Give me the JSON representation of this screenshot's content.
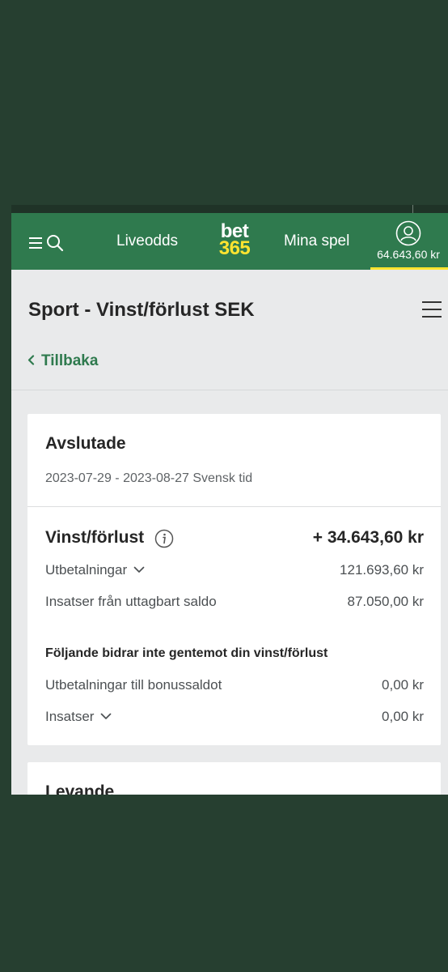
{
  "nav": {
    "live_label": "Liveodds",
    "logo_top": "bet",
    "logo_bottom": "365",
    "mybets_label": "Mina spel",
    "balance": "64.643,60 kr"
  },
  "page": {
    "title": "Sport - Vinst/förlust SEK",
    "back_label": "Tillbaka"
  },
  "settled": {
    "heading": "Avslutade",
    "date_range": "2023-07-29 - 2023-08-27 Svensk tid",
    "pl_label": "Vinst/förlust",
    "pl_value": "+ 34.643,60 kr",
    "rows": [
      {
        "label": "Utbetalningar",
        "value": "121.693,60 kr"
      },
      {
        "label": "Insatser från uttagbart saldo",
        "value": "87.050,00 kr"
      }
    ],
    "note": "Följande bidrar inte gentemot din vinst/förlust",
    "excluded_rows": [
      {
        "label": "Utbetalningar till bonussaldot",
        "value": "0,00 kr"
      },
      {
        "label": "Insatser",
        "value": "0,00 kr"
      }
    ]
  },
  "live": {
    "heading": "Levande"
  },
  "colors": {
    "brand_green": "#2f7a4e",
    "accent_yellow": "#ffe430",
    "background": "#263f30"
  }
}
